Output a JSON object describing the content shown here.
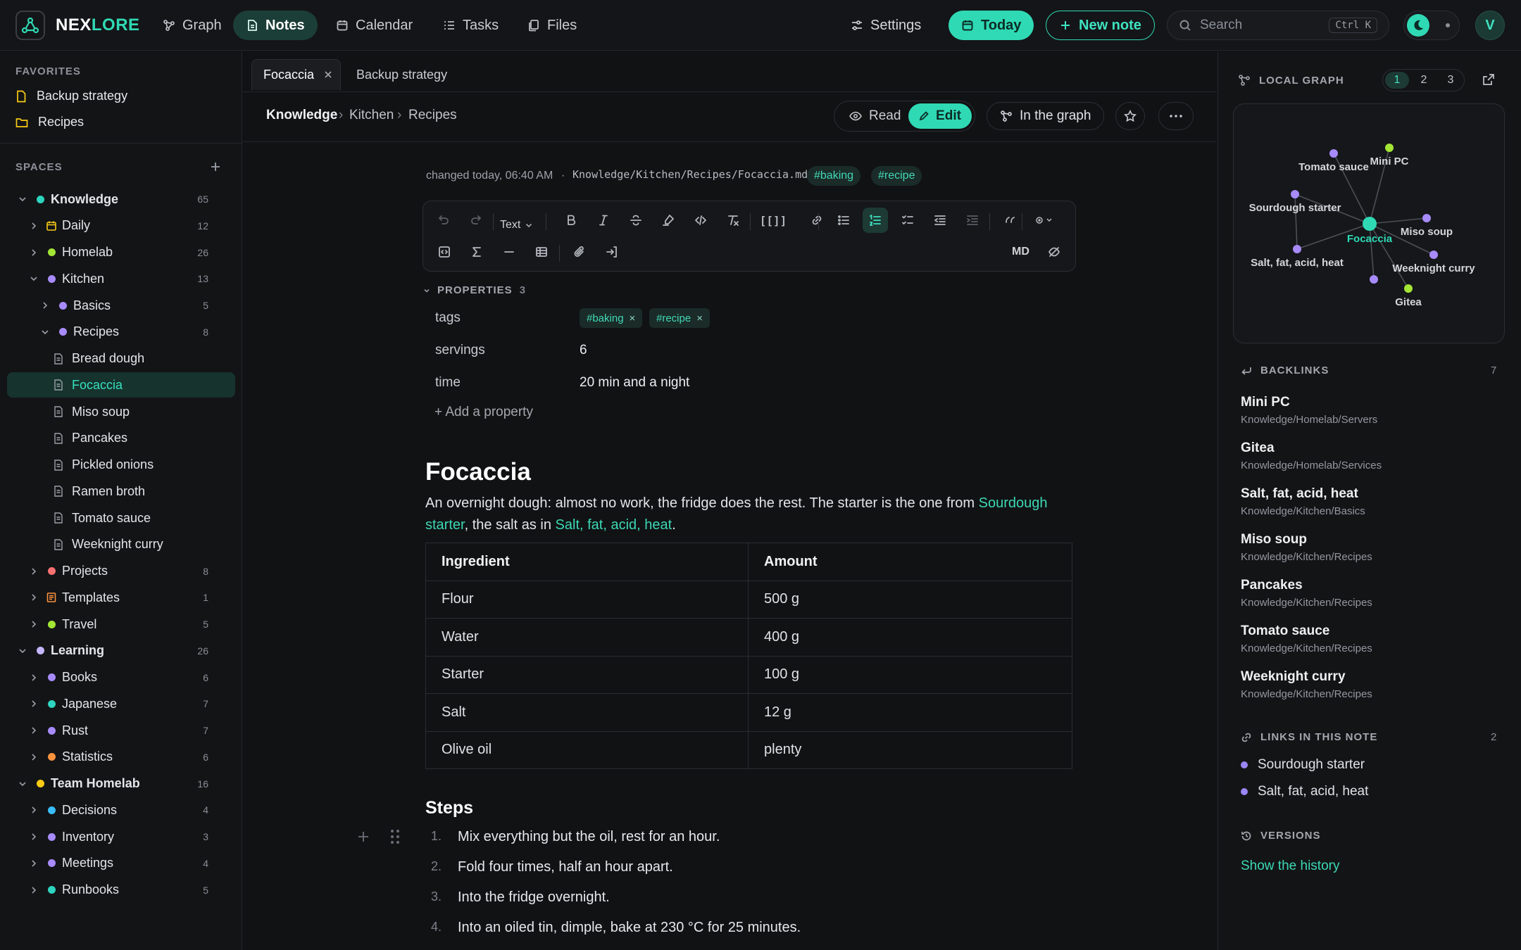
{
  "app": {
    "brand_a": "NEX",
    "brand_b": "LORE"
  },
  "nav": [
    {
      "label": "Graph",
      "icon": "graph-icon"
    },
    {
      "label": "Notes",
      "icon": "note-icon",
      "active": true
    },
    {
      "label": "Calendar",
      "icon": "calendar-icon"
    },
    {
      "label": "Tasks",
      "icon": "tasks-icon"
    },
    {
      "label": "Files",
      "icon": "files-icon"
    }
  ],
  "topright": {
    "settings": "Settings",
    "today": "Today",
    "new_note": "New note",
    "search_placeholder": "Search",
    "search_kbd": "Ctrl K",
    "avatar": "V"
  },
  "colors": {
    "accent": "#2fd9b4",
    "accent_bg": "#1c3e38",
    "purple": "#9b86f5",
    "green": "#a3e635",
    "teal": "#2dd4bf",
    "red": "#f87171",
    "orange": "#fb923c",
    "yellow": "#facc15",
    "blue": "#38bdf8"
  },
  "sidebar": {
    "favorites_title": "FAVORITES",
    "favorites": [
      {
        "label": "Backup strategy",
        "icon": "file-icon"
      },
      {
        "label": "Recipes",
        "icon": "folder-icon"
      }
    ],
    "spaces_title": "SPACES",
    "tree": [
      {
        "label": "Knowledge",
        "count": "65",
        "level": 0,
        "type": "space",
        "color": "#2dd4bf",
        "open": true
      },
      {
        "label": "Daily",
        "count": "12",
        "level": 1,
        "type": "calendar",
        "color": "#facc15",
        "open": false
      },
      {
        "label": "Homelab",
        "count": "26",
        "level": 1,
        "type": "folder",
        "color": "#a3e635",
        "open": false
      },
      {
        "label": "Kitchen",
        "count": "13",
        "level": 1,
        "type": "folder",
        "color": "#a78bfa",
        "open": true
      },
      {
        "label": "Basics",
        "count": "5",
        "level": 2,
        "type": "folder",
        "color": "#a78bfa",
        "open": false
      },
      {
        "label": "Recipes",
        "count": "8",
        "level": 2,
        "type": "folder",
        "color": "#a78bfa",
        "open": true
      },
      {
        "label": "Bread dough",
        "level": 3,
        "type": "doc"
      },
      {
        "label": "Focaccia",
        "level": 3,
        "type": "doc",
        "selected": true
      },
      {
        "label": "Miso soup",
        "level": 3,
        "type": "doc"
      },
      {
        "label": "Pancakes",
        "level": 3,
        "type": "doc"
      },
      {
        "label": "Pickled onions",
        "level": 3,
        "type": "doc"
      },
      {
        "label": "Ramen broth",
        "level": 3,
        "type": "doc"
      },
      {
        "label": "Tomato sauce",
        "level": 3,
        "type": "doc"
      },
      {
        "label": "Weeknight curry",
        "level": 3,
        "type": "doc"
      },
      {
        "label": "Projects",
        "count": "8",
        "level": 1,
        "type": "folder",
        "color": "#f87171",
        "open": false
      },
      {
        "label": "Templates",
        "count": "1",
        "level": 1,
        "type": "template",
        "color": "#fb923c",
        "open": false
      },
      {
        "label": "Travel",
        "count": "5",
        "level": 1,
        "type": "folder",
        "color": "#a3e635",
        "open": false
      },
      {
        "label": "Learning",
        "count": "26",
        "level": 0,
        "type": "space",
        "color": "#c4b5fd",
        "open": true
      },
      {
        "label": "Books",
        "count": "6",
        "level": 1,
        "type": "folder",
        "color": "#a78bfa",
        "open": false
      },
      {
        "label": "Japanese",
        "count": "7",
        "level": 1,
        "type": "folder",
        "color": "#2dd4bf",
        "open": false
      },
      {
        "label": "Rust",
        "count": "7",
        "level": 1,
        "type": "folder",
        "color": "#a78bfa",
        "open": false
      },
      {
        "label": "Statistics",
        "count": "6",
        "level": 1,
        "type": "folder",
        "color": "#fb923c",
        "open": false
      },
      {
        "label": "Team Homelab",
        "count": "16",
        "level": 0,
        "type": "space",
        "color": "#facc15",
        "open": true
      },
      {
        "label": "Decisions",
        "count": "4",
        "level": 1,
        "type": "folder",
        "color": "#38bdf8",
        "open": false
      },
      {
        "label": "Inventory",
        "count": "3",
        "level": 1,
        "type": "folder",
        "color": "#a78bfa",
        "open": false
      },
      {
        "label": "Meetings",
        "count": "4",
        "level": 1,
        "type": "folder",
        "color": "#a78bfa",
        "open": false
      },
      {
        "label": "Runbooks",
        "count": "5",
        "level": 1,
        "type": "folder",
        "color": "#2dd4bf",
        "open": false
      }
    ]
  },
  "tabs": [
    {
      "label": "Focaccia",
      "active": true
    },
    {
      "label": "Backup strategy"
    }
  ],
  "breadcrumb": [
    "Knowledge",
    "Kitchen",
    "Recipes"
  ],
  "header_buttons": {
    "read": "Read",
    "edit": "Edit",
    "in_graph": "In the graph"
  },
  "note": {
    "changed": "changed today, 06:40 AM",
    "path": "Knowledge/Kitchen/Recipes/Focaccia.md",
    "tags": [
      "#baking",
      "#recipe"
    ],
    "toolbar_text_style": "Text",
    "toolbar_md": "MD",
    "properties_title": "PROPERTIES",
    "properties_count": "3",
    "properties": [
      {
        "key": "tags",
        "value": ""
      },
      {
        "key": "servings",
        "value": "6"
      },
      {
        "key": "time",
        "value": "20 min and a night"
      }
    ],
    "add_property": "+ Add a property",
    "title": "Focaccia",
    "intro_1": "An overnight dough: almost no work, the fridge does the rest. The starter is the one from ",
    "intro_link_1": "Sourdough starter",
    "intro_2": ", the salt as in ",
    "intro_link_2": "Salt, fat, acid, heat",
    "intro_3": ".",
    "table_headers": [
      "Ingredient",
      "Amount"
    ],
    "table_rows": [
      [
        "Flour",
        "500 g"
      ],
      [
        "Water",
        "400 g"
      ],
      [
        "Starter",
        "100 g"
      ],
      [
        "Salt",
        "12 g"
      ],
      [
        "Olive oil",
        "plenty"
      ]
    ],
    "steps_title": "Steps",
    "steps": [
      "Mix everything but the oil, rest for an hour.",
      "Fold four times, half an hour apart.",
      "Into the fridge overnight.",
      "Into an oiled tin, dimple, bake at 230 °C for 25 minutes."
    ]
  },
  "right": {
    "graph_title": "LOCAL GRAPH",
    "depths": [
      "1",
      "2",
      "3"
    ],
    "graph_nodes": [
      "Tomato sauce",
      "Mini PC",
      "Sourdough starter",
      "Focaccia",
      "Miso soup",
      "Salt, fat, acid, heat",
      "Weeknight curry",
      "Gitea"
    ],
    "backlinks_title": "BACKLINKS",
    "backlinks_count": "7",
    "backlinks": [
      {
        "title": "Mini PC",
        "path": "Knowledge/Homelab/Servers"
      },
      {
        "title": "Gitea",
        "path": "Knowledge/Homelab/Services"
      },
      {
        "title": "Salt, fat, acid, heat",
        "path": "Knowledge/Kitchen/Basics"
      },
      {
        "title": "Miso soup",
        "path": "Knowledge/Kitchen/Recipes"
      },
      {
        "title": "Pancakes",
        "path": "Knowledge/Kitchen/Recipes"
      },
      {
        "title": "Tomato sauce",
        "path": "Knowledge/Kitchen/Recipes"
      },
      {
        "title": "Weeknight curry",
        "path": "Knowledge/Kitchen/Recipes"
      }
    ],
    "links_title": "LINKS IN THIS NOTE",
    "links_count": "2",
    "links": [
      "Sourdough starter",
      "Salt, fat, acid, heat"
    ],
    "versions_title": "VERSIONS",
    "show_history": "Show the history"
  }
}
